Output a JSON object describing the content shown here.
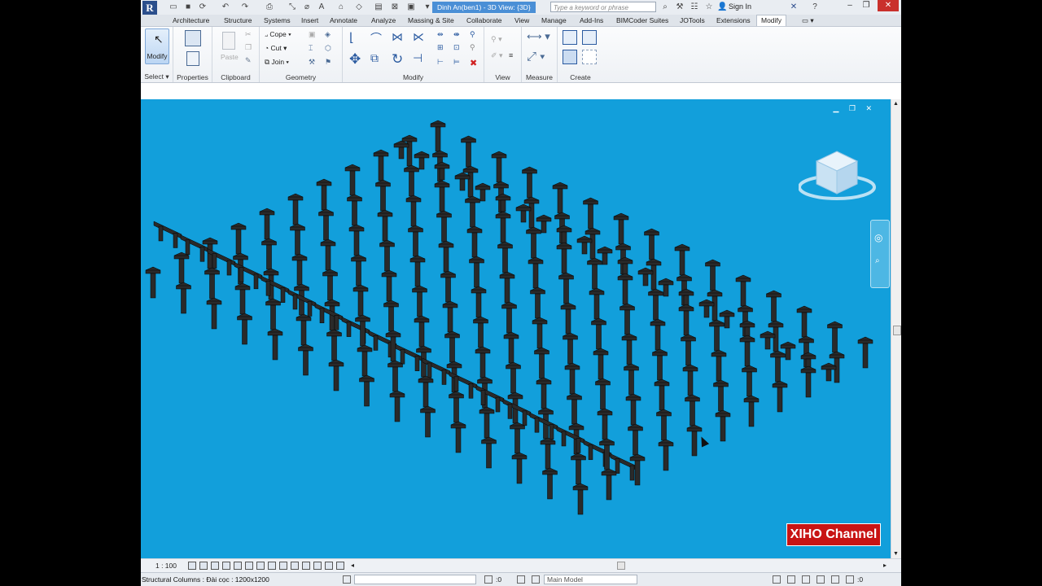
{
  "app": {
    "document_title": "Dinh An(ben1) - 3D View: {3D}",
    "search_placeholder": "Type a keyword or phrase",
    "sign_in": "Sign In",
    "logo": "R"
  },
  "menu_tabs": [
    {
      "label": "Architecture",
      "name": "tab-architecture"
    },
    {
      "label": "Structure",
      "name": "tab-structure"
    },
    {
      "label": "Systems",
      "name": "tab-systems"
    },
    {
      "label": "Insert",
      "name": "tab-insert"
    },
    {
      "label": "Annotate",
      "name": "tab-annotate"
    },
    {
      "label": "Analyze",
      "name": "tab-analyze"
    },
    {
      "label": "Massing & Site",
      "name": "tab-massing-site"
    },
    {
      "label": "Collaborate",
      "name": "tab-collaborate"
    },
    {
      "label": "View",
      "name": "tab-view"
    },
    {
      "label": "Manage",
      "name": "tab-manage"
    },
    {
      "label": "Add-Ins",
      "name": "tab-add-ins"
    },
    {
      "label": "BIMCoder Suites",
      "name": "tab-bimcoder-suites"
    },
    {
      "label": "JOTools",
      "name": "tab-jotools"
    },
    {
      "label": "Extensions",
      "name": "tab-extensions"
    },
    {
      "label": "Modify",
      "name": "tab-modify",
      "active": true
    }
  ],
  "ribbon": {
    "modify_button": "Modify",
    "paste_button": "Paste",
    "cope": "Cope",
    "cut": "Cut",
    "join": "Join",
    "panels": {
      "select": "Select",
      "properties": "Properties",
      "clipboard": "Clipboard",
      "geometry": "Geometry",
      "modify": "Modify",
      "view": "View",
      "measure": "Measure",
      "create": "Create"
    }
  },
  "view_bar": {
    "scale": "1 : 100"
  },
  "status_bar": {
    "text": "Structural Columns : Đài cọc : 1200x1200",
    "filter_value": ":0",
    "model": "Main Model",
    "selection_count": ":0"
  },
  "watermark": "XIHO Channel",
  "colors": {
    "viewport_bg": "#129fdb",
    "column_fill": "#2a2a2a",
    "active_doc_tab": "#4a8fd6",
    "watermark_bg": "#c81414"
  }
}
